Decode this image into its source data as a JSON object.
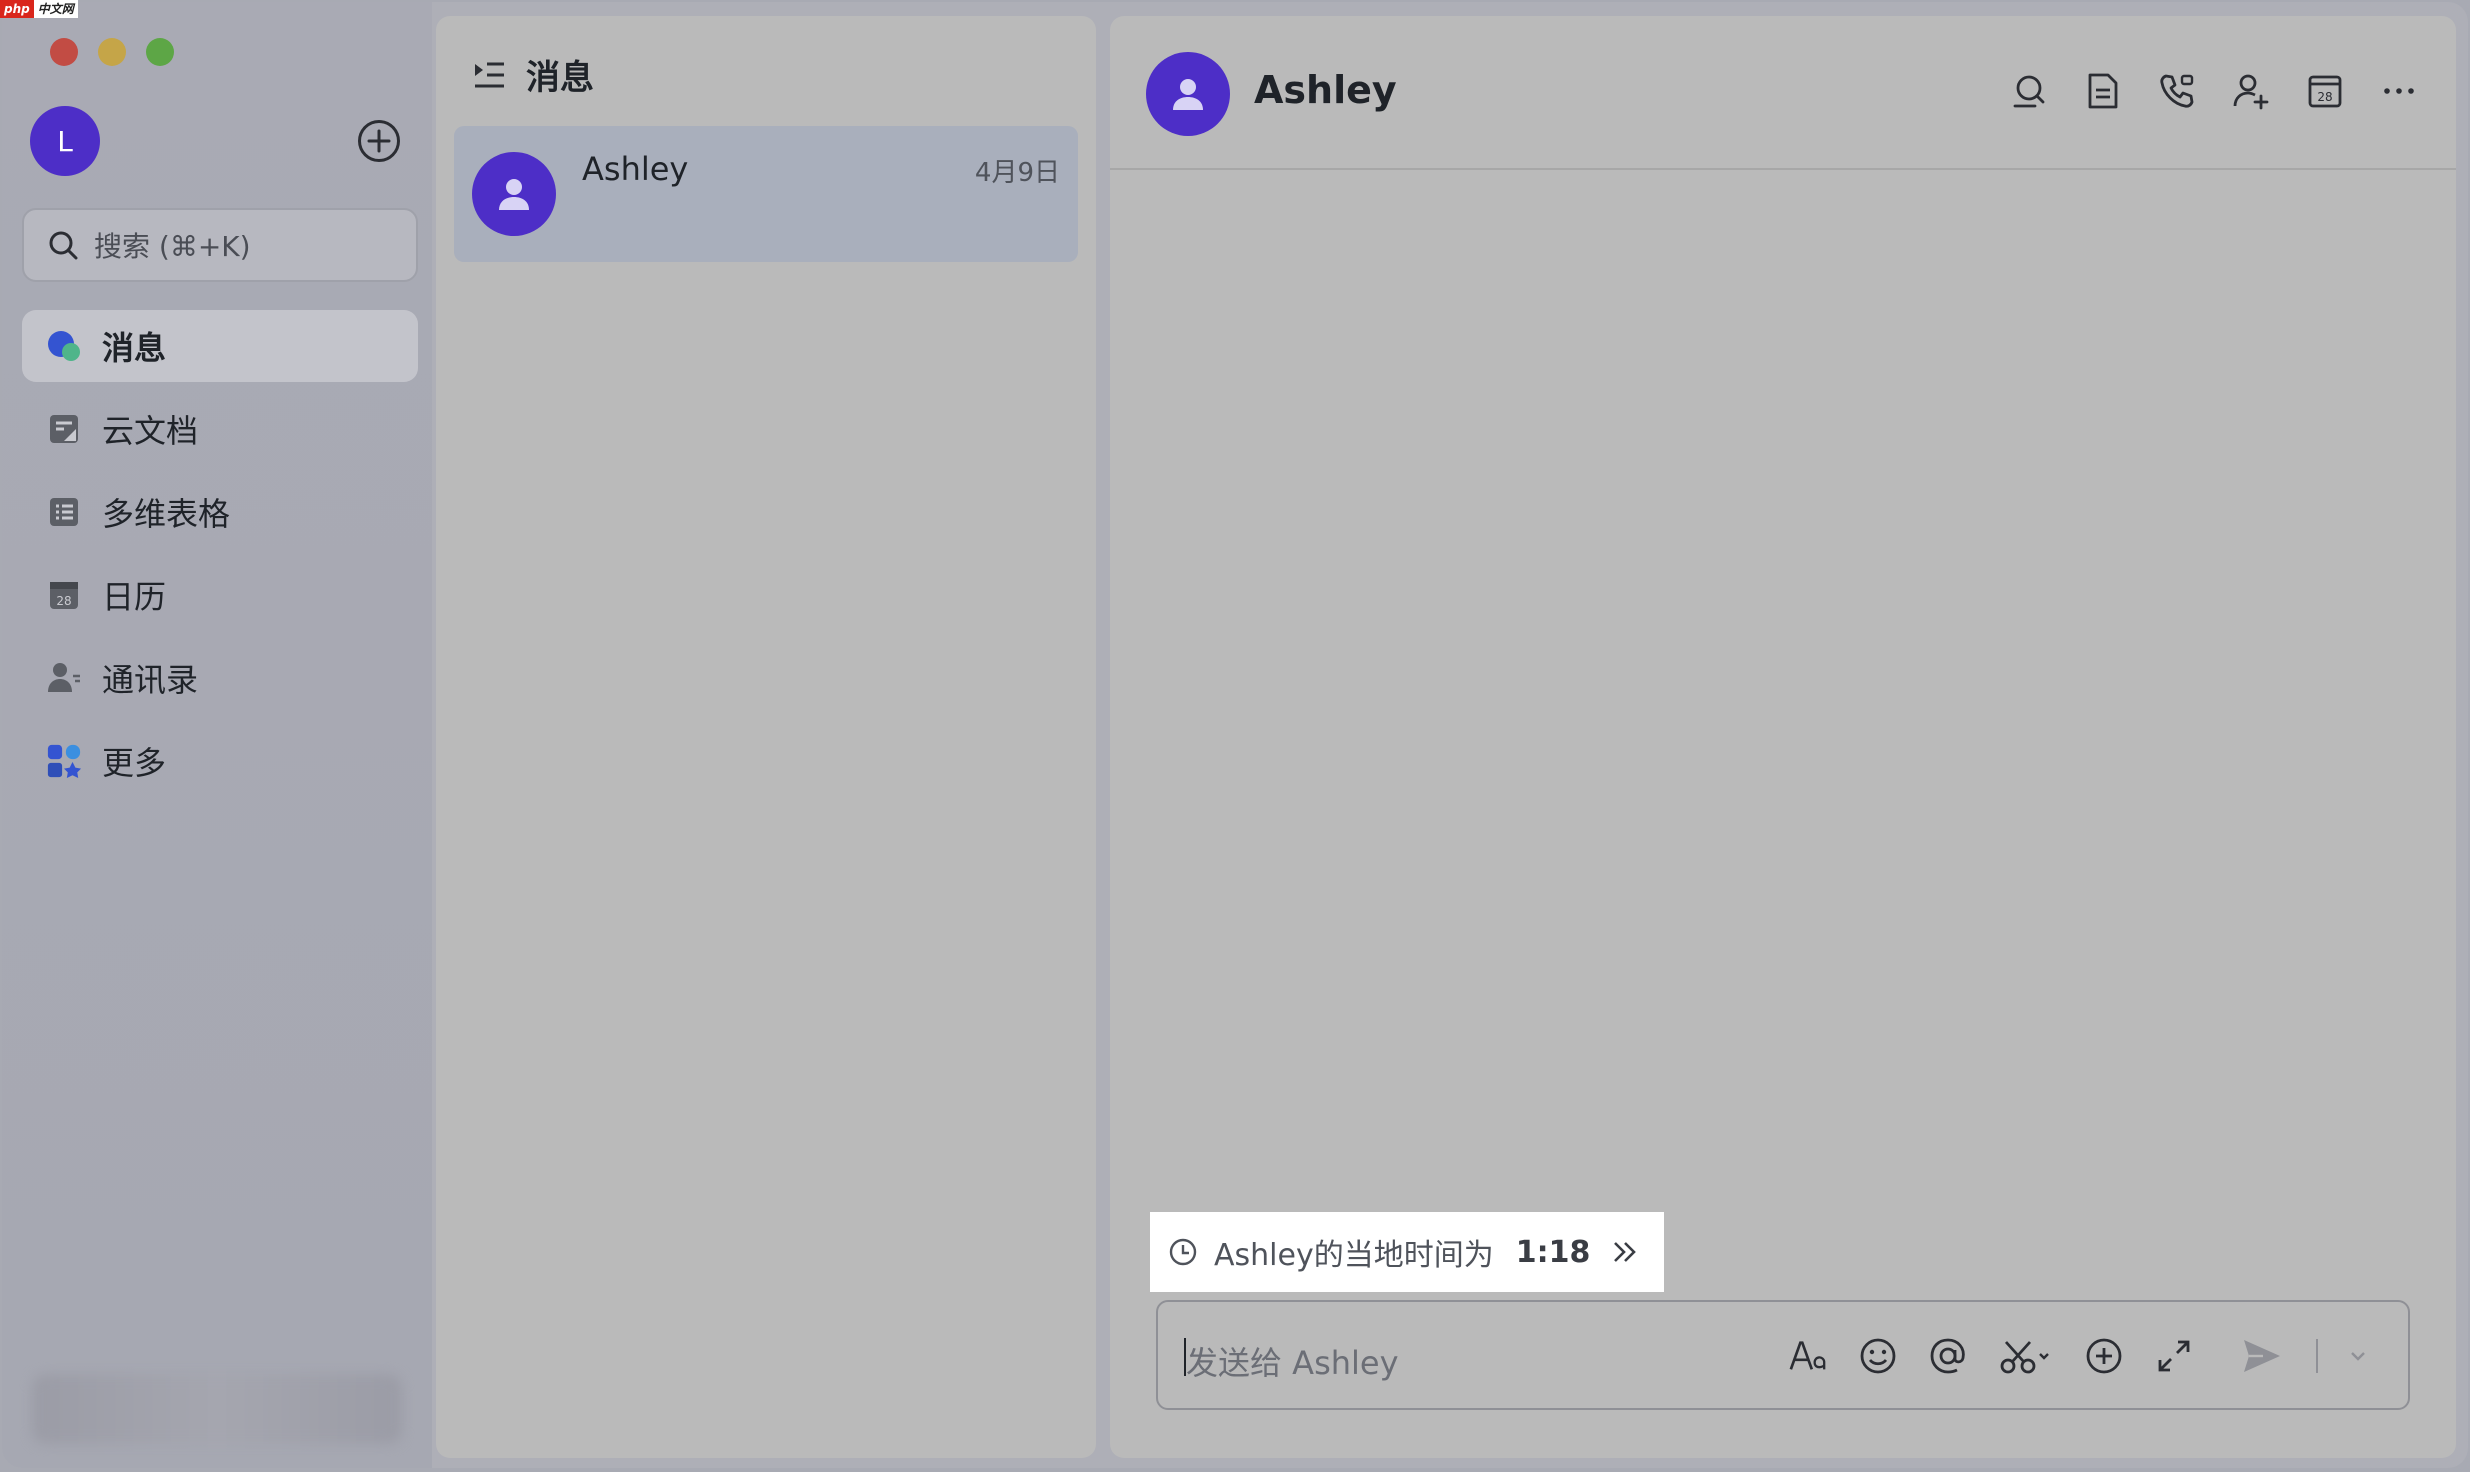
{
  "watermark": {
    "part1": "php",
    "part2": "中文网"
  },
  "sidebar": {
    "avatar_initial": "L",
    "search_placeholder": "搜索 (⌘+K)",
    "items": [
      {
        "label": "消息",
        "icon": "message-icon",
        "active": true
      },
      {
        "label": "云文档",
        "icon": "docs-icon",
        "active": false
      },
      {
        "label": "多维表格",
        "icon": "base-table-icon",
        "active": false
      },
      {
        "label": "日历",
        "icon": "calendar-icon",
        "active": false
      },
      {
        "label": "通讯录",
        "icon": "contacts-icon",
        "active": false
      },
      {
        "label": "更多",
        "icon": "more-apps-icon",
        "active": false
      }
    ],
    "calendar_day": "28"
  },
  "chat_list": {
    "title": "消息",
    "chats": [
      {
        "name": "Ashley",
        "date": "4月9日"
      }
    ]
  },
  "conversation": {
    "name": "Ashley",
    "calendar_day": "28",
    "local_time_label": "Ashley的当地时间为",
    "local_time": "1:18",
    "composer_placeholder": "发送给 Ashley"
  },
  "colors": {
    "accent_purple": "#4d2ec7",
    "panel_gray": "#bababa",
    "selected_chat": "#a9afbc"
  }
}
